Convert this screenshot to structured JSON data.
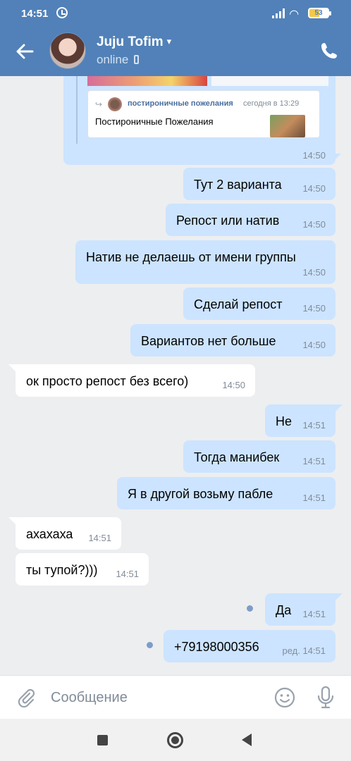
{
  "status_bar": {
    "time": "14:51",
    "battery": "53"
  },
  "header": {
    "name": "Juju Tofim",
    "status": "online"
  },
  "forwarded": {
    "group_name": "постироничные пожелания",
    "post_date": "сегодня в 13:29",
    "post_text": "Постироничные Пожелания",
    "time": "14:50"
  },
  "messages": [
    {
      "dir": "out",
      "text": "Тут 2 варианта",
      "time": "14:50"
    },
    {
      "dir": "out",
      "text": "Репост или натив",
      "time": "14:50"
    },
    {
      "dir": "out",
      "text": "Натив не делаешь от имени группы",
      "time": "14:50"
    },
    {
      "dir": "out",
      "text": "Сделай репост",
      "time": "14:50"
    },
    {
      "dir": "out",
      "text": "Вариантов нет больше",
      "time": "14:50"
    },
    {
      "dir": "in",
      "text": "ок просто репост без всего)",
      "time": "14:50"
    },
    {
      "dir": "out",
      "text": "Не",
      "time": "14:51"
    },
    {
      "dir": "out",
      "text": "Тогда манибек",
      "time": "14:51"
    },
    {
      "dir": "out",
      "text": "Я в другой возьму пабле",
      "time": "14:51"
    },
    {
      "dir": "in",
      "text": "ахахаха",
      "time": "14:51"
    },
    {
      "dir": "in",
      "text": "ты тупой?)))",
      "time": "14:51"
    },
    {
      "dir": "out",
      "text": "Да",
      "time": "14:51"
    },
    {
      "dir": "out",
      "text": "+79198000356",
      "time": "ред. 14:51"
    }
  ],
  "composer": {
    "placeholder": "Сообщение"
  },
  "icons": {
    "back": "arrow-left-icon",
    "call": "phone-icon",
    "attach": "paperclip-icon",
    "emoji": "smiley-icon",
    "mic": "microphone-icon"
  },
  "colors": {
    "header": "#5181b8",
    "outgoing": "#cce4ff",
    "incoming": "#ffffff",
    "background": "#edeef0"
  }
}
